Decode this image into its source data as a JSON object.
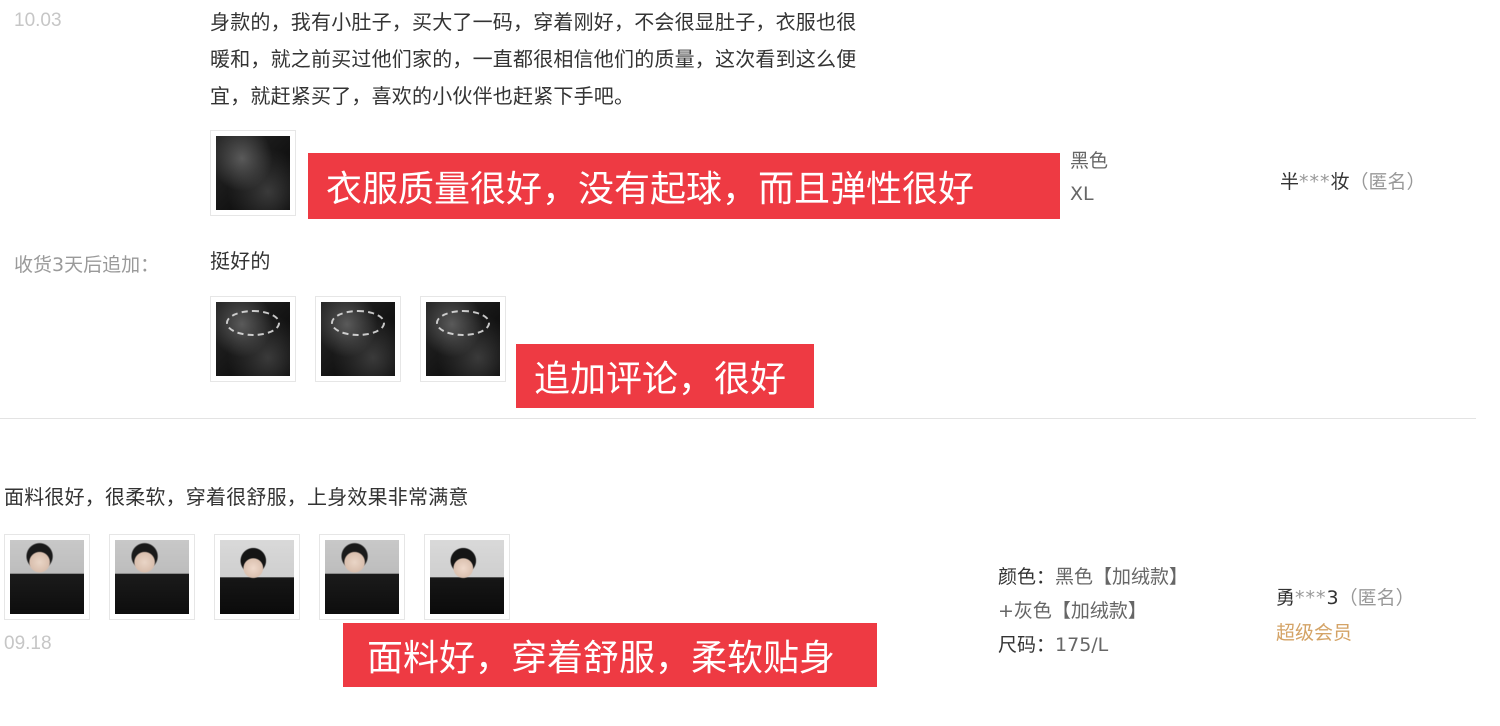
{
  "review1": {
    "date": "10.03",
    "text_lines": [
      "身款的，我有小肚子，买大了一码，穿着刚好，不会很显肚子，衣服也很",
      "暖和，就之前买过他们家的，一直都很相信他们的质量，这次看到这么便",
      "宜，就赶紧买了，喜欢的小伙伴也赶紧下手吧。"
    ],
    "color_value": "黑色",
    "size_value": "XL",
    "user": {
      "name_start": "半",
      "stars": "***",
      "name_end": "妆",
      "anon": "（匿名）"
    },
    "banner": "衣服质量很好，没有起球，而且弹性很好",
    "append": {
      "label": "收货3天后追加：",
      "text": "挺好的",
      "banner": "追加评论，很好"
    }
  },
  "review2": {
    "text": "面料很好，很柔软，穿着很舒服，上身效果非常满意",
    "date": "09.18",
    "meta": {
      "color_key": "颜色：",
      "color_value": "黑色【加绒款】",
      "color_value2": "+灰色【加绒款】",
      "size_key": "尺码：",
      "size_value": "175/L"
    },
    "user": {
      "name_start": "勇",
      "stars": "***",
      "name_end": "3",
      "anon": "（匿名）",
      "badge": "超级会员"
    },
    "banner": "面料好，穿着舒服，柔软贴身"
  },
  "colors": {
    "banner_red": "#ee3a43",
    "vip_gold": "#d4a366",
    "date_gray": "#c6c6c6"
  }
}
